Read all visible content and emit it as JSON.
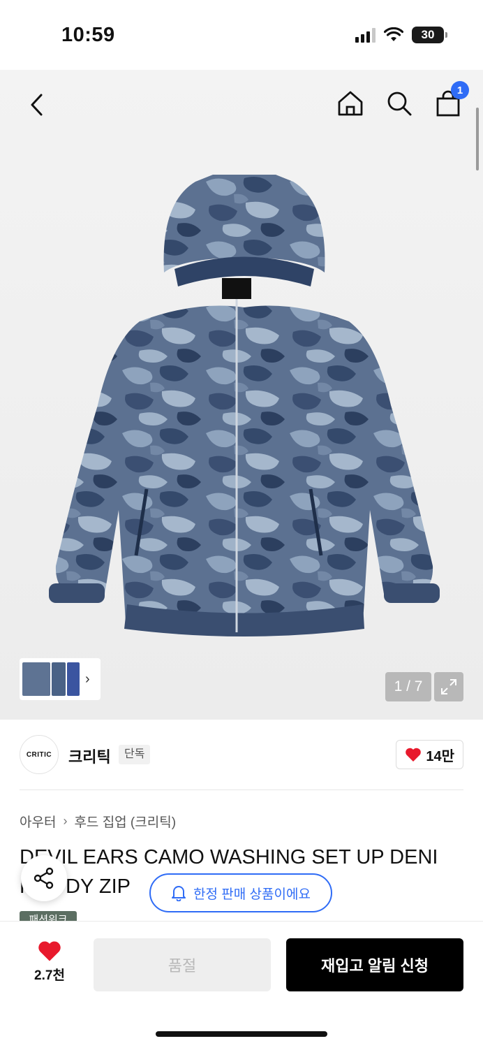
{
  "status_bar": {
    "time": "10:59",
    "battery": "30"
  },
  "header": {
    "cart_count": "1"
  },
  "gallery": {
    "pager": "1 / 7"
  },
  "brand": {
    "logo_text": "CRITIC",
    "name": "크리틱",
    "tag": "단독",
    "likes": "14만"
  },
  "breadcrumb": {
    "category": "아우터",
    "subcategory": "후드 집업 (크리틱)"
  },
  "product": {
    "title_line1": "DEVIL EARS CAMO WASHING SET UP DENI",
    "title_line2": "HOODY ZIP",
    "limited_label": "한정 판매 상품이에요",
    "partial_badge": "패션위크"
  },
  "bottom_bar": {
    "wish_count": "2.7천",
    "soldout_label": "품절",
    "restock_label": "재입고 알림 신청"
  },
  "colors": {
    "accent": "#2f6cf6",
    "heart": "#e8192c",
    "primary_button": "#000000"
  }
}
